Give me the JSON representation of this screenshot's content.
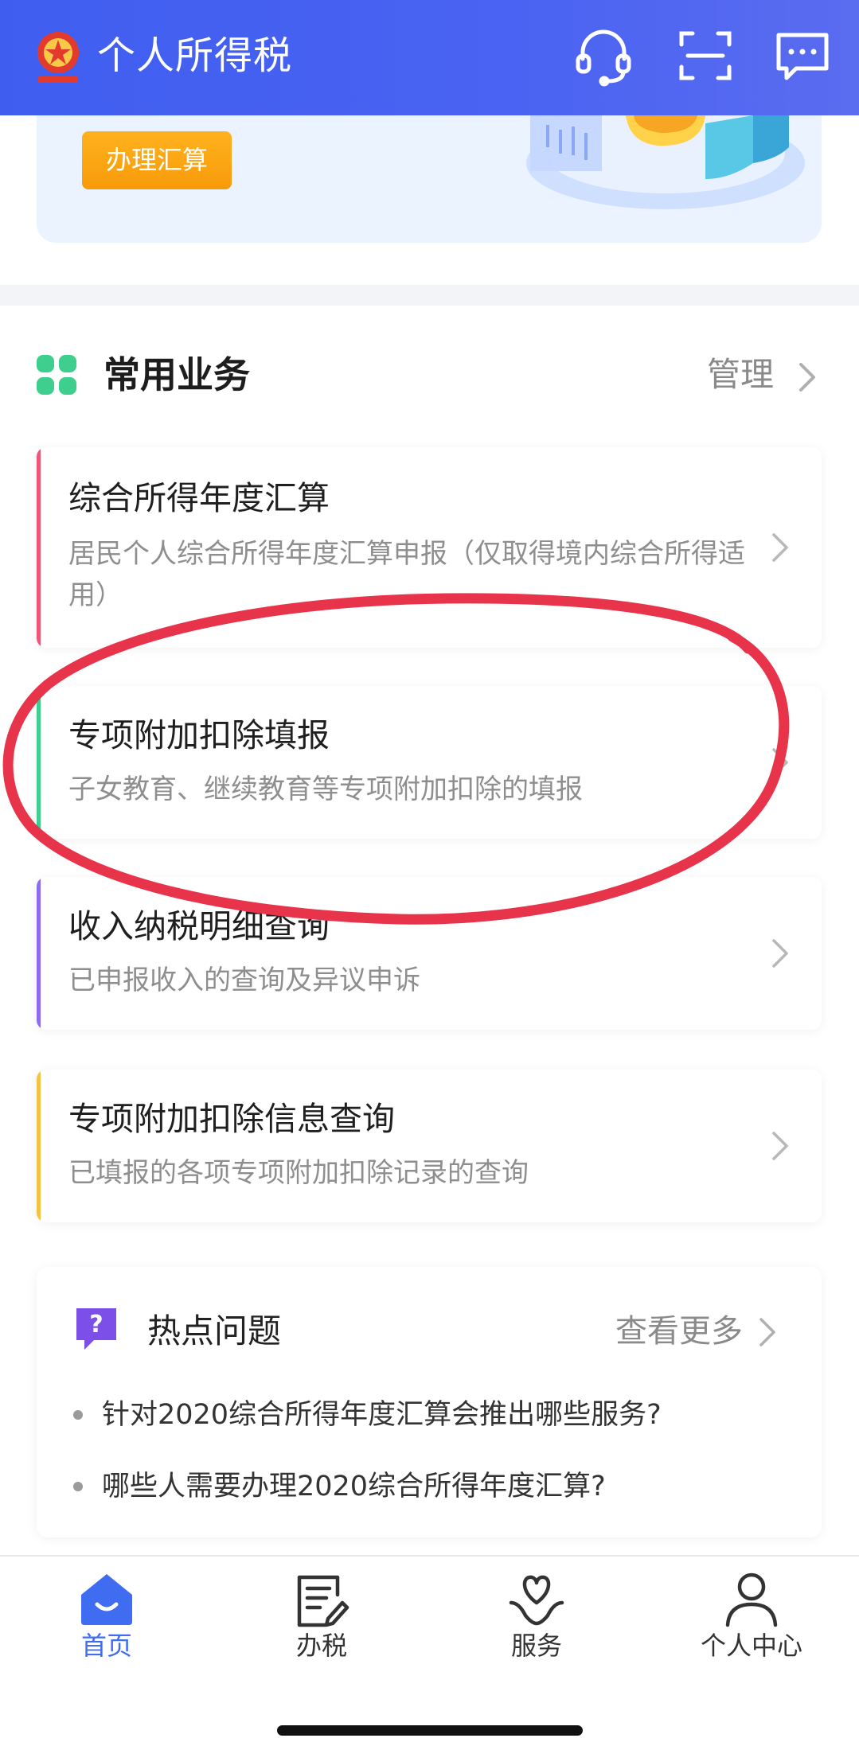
{
  "header": {
    "title": "个人所得税",
    "logo_icon": "tax-emblem-icon",
    "icons": [
      "headset-icon",
      "scan-icon",
      "message-icon"
    ],
    "background": "#4a63f2"
  },
  "banner": {
    "button_label": "办理汇算"
  },
  "common": {
    "title": "常用业务",
    "manage_label": "管理",
    "items": [
      {
        "title": "综合所得年度汇算",
        "desc": "居民个人综合所得年度汇算申报（仅取得境内综合所得适用）",
        "color": "#f05577"
      },
      {
        "title": "专项附加扣除填报",
        "desc": "子女教育、继续教育等专项附加扣除的填报",
        "color": "#3ecf8e"
      },
      {
        "title": "收入纳税明细查询",
        "desc": "已申报收入的查询及异议申诉",
        "color": "#8b6cf0"
      },
      {
        "title": "专项附加扣除信息查询",
        "desc": "已填报的各项专项附加扣除记录的查询",
        "color": "#f5c342"
      }
    ]
  },
  "hot": {
    "title": "热点问题",
    "more_label": "查看更多",
    "questions": [
      "针对2020综合所得年度汇算会推出哪些服务?",
      "哪些人需要办理2020综合所得年度汇算?"
    ]
  },
  "nav": {
    "items": [
      {
        "label": "首页",
        "icon": "home-icon",
        "active": true
      },
      {
        "label": "办税",
        "icon": "tax-form-icon",
        "active": false
      },
      {
        "label": "服务",
        "icon": "service-heart-icon",
        "active": false
      },
      {
        "label": "个人中心",
        "icon": "person-icon",
        "active": false
      }
    ],
    "active_color": "#3f6cf0"
  },
  "annotation_color": "#e8344a"
}
